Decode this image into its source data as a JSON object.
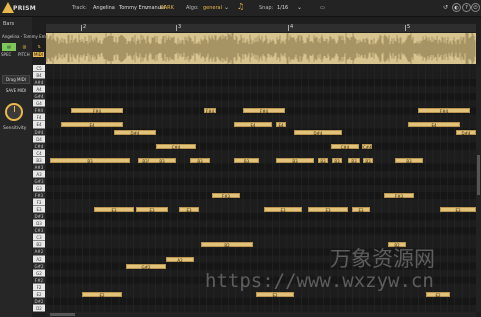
{
  "app": {
    "logo_text": "PRISM"
  },
  "toolbar": {
    "track_label": "Track:",
    "track_value": "Angelina",
    "artist_value": "Tommy Emmanuel",
    "dark_label": "DARK",
    "algo_label": "Algo:",
    "algo_value": "general",
    "snap_label": "Snap:",
    "snap_value": "1/16"
  },
  "sidebar": {
    "bars_label": "Bars",
    "track_names": "Angelina - Tommy Emma...",
    "mode_buttons": [
      "SPEC",
      "PITCH",
      "MIDI"
    ],
    "drag_midi": "Drag MIDI",
    "save_midi": "SAVE MIDI",
    "sensitivity": "Sensitivity"
  },
  "ruler": {
    "ticks": [
      "2",
      "3",
      "4",
      "5"
    ]
  },
  "piano_keys": [
    "C5",
    "B4",
    "A#4",
    "A4",
    "G#4",
    "G4",
    "F#4",
    "F4",
    "E4",
    "D#4",
    "D4",
    "C#4",
    "C4",
    "B3",
    "A#3",
    "A3",
    "G#3",
    "G3",
    "F#3",
    "F3",
    "E3",
    "D#3",
    "D3",
    "C#3",
    "C3",
    "B2",
    "A#2",
    "A2",
    "G#2",
    "G2",
    "F#2",
    "F2",
    "E2",
    "D#2",
    "D2"
  ],
  "notes": [
    {
      "label": "F#4"
    },
    {
      "label": "F#4"
    },
    {
      "label": "F#4"
    },
    {
      "label": "F#4"
    },
    {
      "label": "E4"
    },
    {
      "label": "E4"
    },
    {
      "label": "E4"
    },
    {
      "label": "E4"
    },
    {
      "label": "D#4"
    },
    {
      "label": "D#4"
    },
    {
      "label": "D#4"
    },
    {
      "label": "C#4"
    },
    {
      "label": "C#4"
    },
    {
      "label": "C#4"
    },
    {
      "label": "B3"
    },
    {
      "label": "B3"
    },
    {
      "label": "B3"
    },
    {
      "label": "B3"
    },
    {
      "label": "B3"
    },
    {
      "label": "B3"
    },
    {
      "label": "B3"
    },
    {
      "label": "B3"
    },
    {
      "label": "B3"
    },
    {
      "label": "B3"
    },
    {
      "label": "B3"
    },
    {
      "label": "F#3"
    },
    {
      "label": "F#3"
    },
    {
      "label": "E3"
    },
    {
      "label": "E3"
    },
    {
      "label": "E3"
    },
    {
      "label": "E3"
    },
    {
      "label": "E3"
    },
    {
      "label": "E3"
    },
    {
      "label": "E3"
    },
    {
      "label": "B2"
    },
    {
      "label": "B2"
    },
    {
      "label": "A2"
    },
    {
      "label": "G#2"
    },
    {
      "label": "E2"
    },
    {
      "label": "E2"
    },
    {
      "label": "E2"
    }
  ],
  "watermark": {
    "cn": "万象资源网",
    "url": "https://www.wxzyw.cn"
  },
  "colors": {
    "accent": "#e9b84a",
    "note_fill": "#e3c37a",
    "waveform": "#d7c48f",
    "background": "#1a1a1a"
  }
}
